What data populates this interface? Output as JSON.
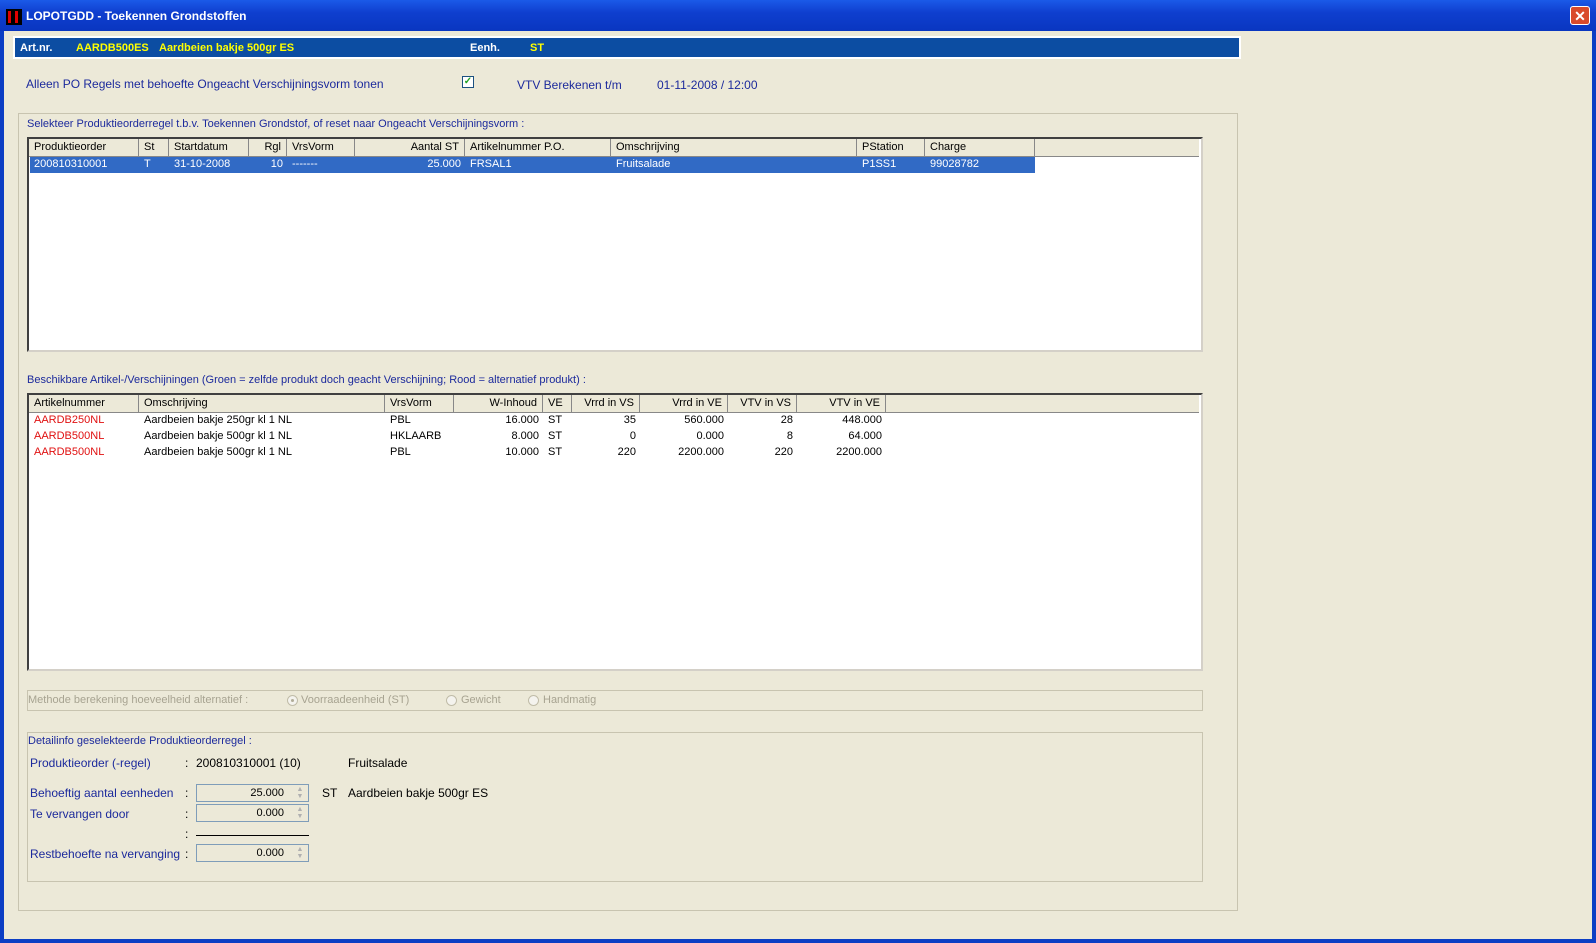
{
  "window": {
    "title": "LOPOTGDD - Toekennen Grondstoffen",
    "close_glyph": "✕"
  },
  "infobar": {
    "art_label": "Art.nr.",
    "art_code": "AARDB500ES",
    "art_desc": "Aardbeien bakje 500gr ES",
    "unit_label": "Eenh.",
    "unit_value": "ST"
  },
  "filter": {
    "label": "Alleen PO Regels met behoefte Ongeacht Verschijningsvorm tonen",
    "checked": true,
    "vtv_label": "VTV Berekenen t/m",
    "vtv_value": "01-11-2008 / 12:00"
  },
  "po_section": {
    "caption": "Selekteer Produktieorderregel t.b.v. Toekennen Grondstof, of reset naar Ongeacht Verschijningsvorm :",
    "columns": [
      "Produktieorder",
      "St",
      "Startdatum",
      "Rgl",
      "VrsVorm",
      "Aantal ST",
      "Artikelnummer P.O.",
      "Omschrijving",
      "PStation",
      "Charge"
    ],
    "rows": [
      [
        "200810310001",
        "T",
        "31-10-2008",
        "10",
        "-------",
        "25.000",
        "FRSAL1",
        "Fruitsalade",
        "P1SS1",
        "99028782"
      ]
    ]
  },
  "art_section": {
    "caption": "Beschikbare Artikel-/Verschijningen (Groen = zelfde produkt doch geacht Verschijning; Rood = alternatief produkt) :",
    "columns": [
      "Artikelnummer",
      "Omschrijving",
      "VrsVorm",
      "W-Inhoud",
      "VE",
      "Vrrd in VS",
      "Vrrd in VE",
      "VTV in VS",
      "VTV in VE"
    ],
    "rows": [
      [
        "AARDB250NL",
        "Aardbeien bakje 250gr kl 1 NL",
        "PBL",
        "16.000",
        "ST",
        "35",
        "560.000",
        "28",
        "448.000"
      ],
      [
        "AARDB500NL",
        "Aardbeien bakje 500gr kl 1 NL",
        "HKLAARB",
        "8.000",
        "ST",
        "0",
        "0.000",
        "8",
        "64.000"
      ],
      [
        "AARDB500NL",
        "Aardbeien bakje 500gr kl 1 NL",
        "PBL",
        "10.000",
        "ST",
        "220",
        "2200.000",
        "220",
        "2200.000"
      ]
    ]
  },
  "method": {
    "label": "Methode berekening hoeveelheid alternatief :",
    "options": [
      "Voorraadeenheid (ST)",
      "Gewicht",
      "Handmatig"
    ],
    "selected": 0
  },
  "detail": {
    "caption": "Detailinfo geselekteerde Produktieorderregel :",
    "po_label": "Produktieorder (-regel)",
    "po_value": "200810310001 (10)",
    "po_desc": "Fruitsalade",
    "need_label": "Behoeftig aantal eenheden",
    "need_value": "25.000",
    "need_unit": "ST",
    "need_desc": "Aardbeien bakje 500gr ES",
    "replace_label": "Te vervangen door",
    "replace_value": "0.000",
    "rest_label": "Restbehoefte na vervanging",
    "rest_value": "0.000",
    "colon": ":"
  }
}
